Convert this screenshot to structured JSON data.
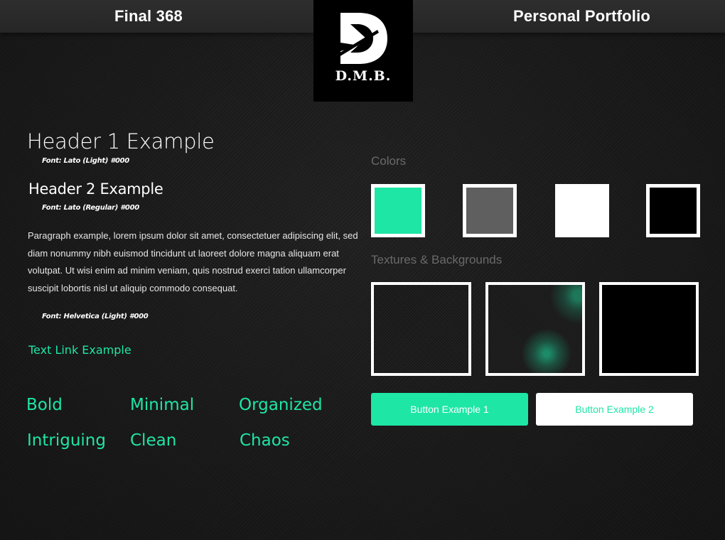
{
  "header": {
    "left_title": "Final 368",
    "right_title": "Personal Portfolio",
    "logo_text": "D.M.B."
  },
  "typography": {
    "h1": "Header 1 Example",
    "h1_font": "Font: Lato (Light) #000",
    "h2": "Header 2 Example",
    "h2_font": "Font: Lato (Regular) #000",
    "paragraph": "Paragraph example, lorem ipsum dolor sit amet, consectetuer adipiscing elit, sed diam nonummy nibh euismod tincidunt ut laoreet dolore magna aliquam erat volutpat. Ut wisi enim ad minim veniam, quis nostrud exerci tation ullamcorper suscipit lobortis nisl ut aliquip commodo consequat.",
    "paragraph_font": "Font: Helvetica (Light) #000",
    "link": "Text Link Example"
  },
  "keywords": [
    "Bold",
    "Minimal",
    "Organized",
    "Intriguing",
    "Clean",
    "Chaos"
  ],
  "colors_section": {
    "label": "Colors",
    "swatches": [
      "#1ee6a5",
      "#5f5f5f",
      "#ffffff",
      "#000000"
    ]
  },
  "textures_section": {
    "label": "Textures & Backgrounds"
  },
  "buttons": {
    "button1": "Button Example 1",
    "button2": "Button Example 2"
  },
  "theme": {
    "accent": "#1ee6a5",
    "background": "#1c1c1c"
  }
}
